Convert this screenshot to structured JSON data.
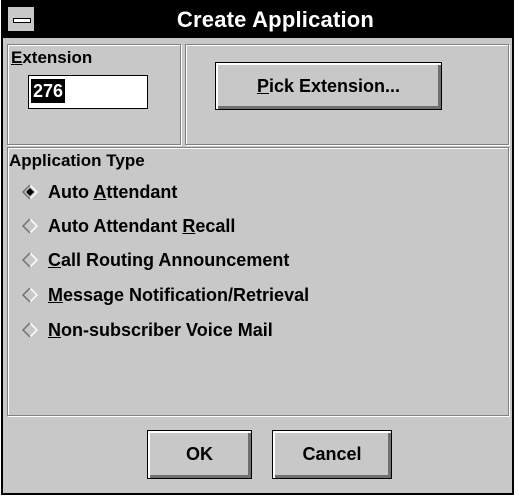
{
  "window": {
    "title": "Create Application"
  },
  "extension": {
    "label_prefix": "",
    "label_accel": "E",
    "label_rest": "xtension",
    "value": "276"
  },
  "pick_button": {
    "accel": "P",
    "rest": "ick Extension..."
  },
  "application_type": {
    "label": "Application Type",
    "options": [
      {
        "pre": "Auto ",
        "accel": "A",
        "post": "ttendant",
        "selected": true
      },
      {
        "pre": "Auto Attendant ",
        "accel": "R",
        "post": "ecall",
        "selected": false
      },
      {
        "pre": "",
        "accel": "C",
        "post": "all Routing Announcement",
        "selected": false
      },
      {
        "pre": "",
        "accel": "M",
        "post": "essage Notification/Retrieval",
        "selected": false
      },
      {
        "pre": "",
        "accel": "N",
        "post": "on-subscriber Voice Mail",
        "selected": false
      }
    ]
  },
  "buttons": {
    "ok_label": "OK",
    "cancel_label": "Cancel"
  }
}
